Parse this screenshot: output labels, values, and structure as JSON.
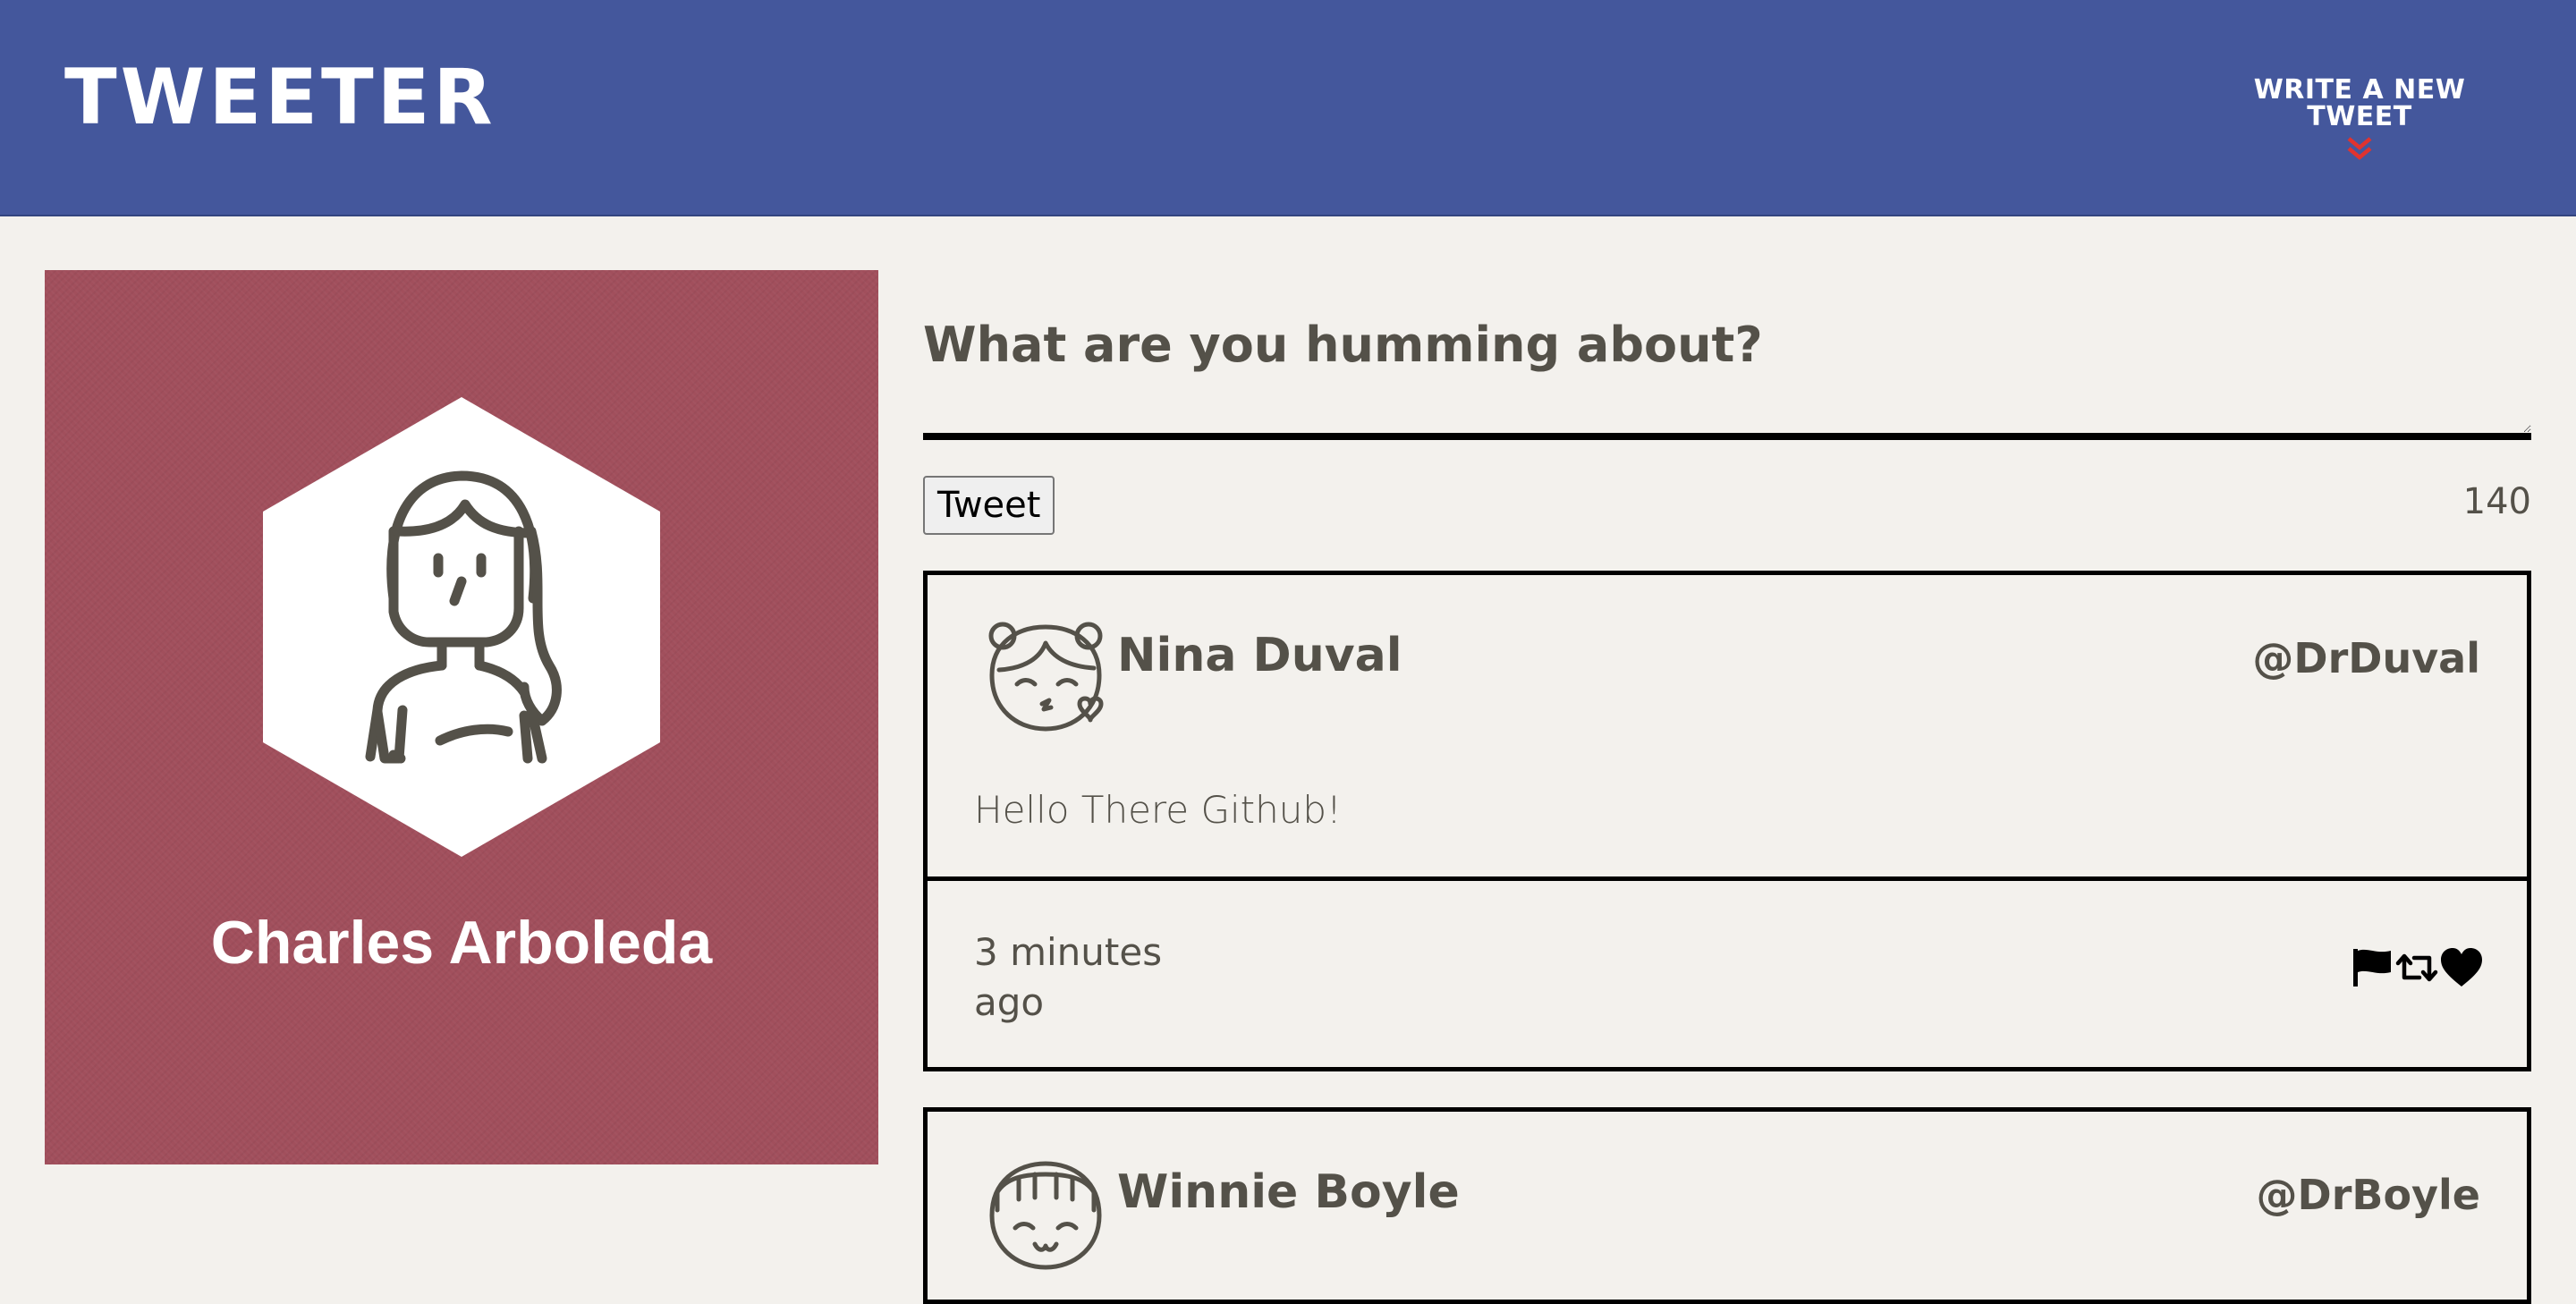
{
  "header": {
    "brand": "TWEETER",
    "compose_label": "WRITE A NEW TWEET",
    "compose_icon": "chevron-double-down-icon",
    "accent_color": "#e0332f",
    "background_color": "#44579c"
  },
  "profile": {
    "name": "Charles Arboleda",
    "avatar_icon": "woman-avatar-icon",
    "background_color": "#a14f5c"
  },
  "composer": {
    "placeholder": "What are you humming about?",
    "button_label": "Tweet",
    "counter": "140"
  },
  "tweets": [
    {
      "name": "Nina Duval",
      "handle": "@DrDuval",
      "avatar_icon": "girl-kissing-avatar-icon",
      "body": "Hello There Github!",
      "time": "3 minutes ago",
      "actions": [
        "flag-icon",
        "retweet-icon",
        "heart-icon"
      ]
    },
    {
      "name": "Winnie Boyle",
      "handle": "@DrBoyle",
      "avatar_icon": "girl-smiling-avatar-icon"
    }
  ]
}
